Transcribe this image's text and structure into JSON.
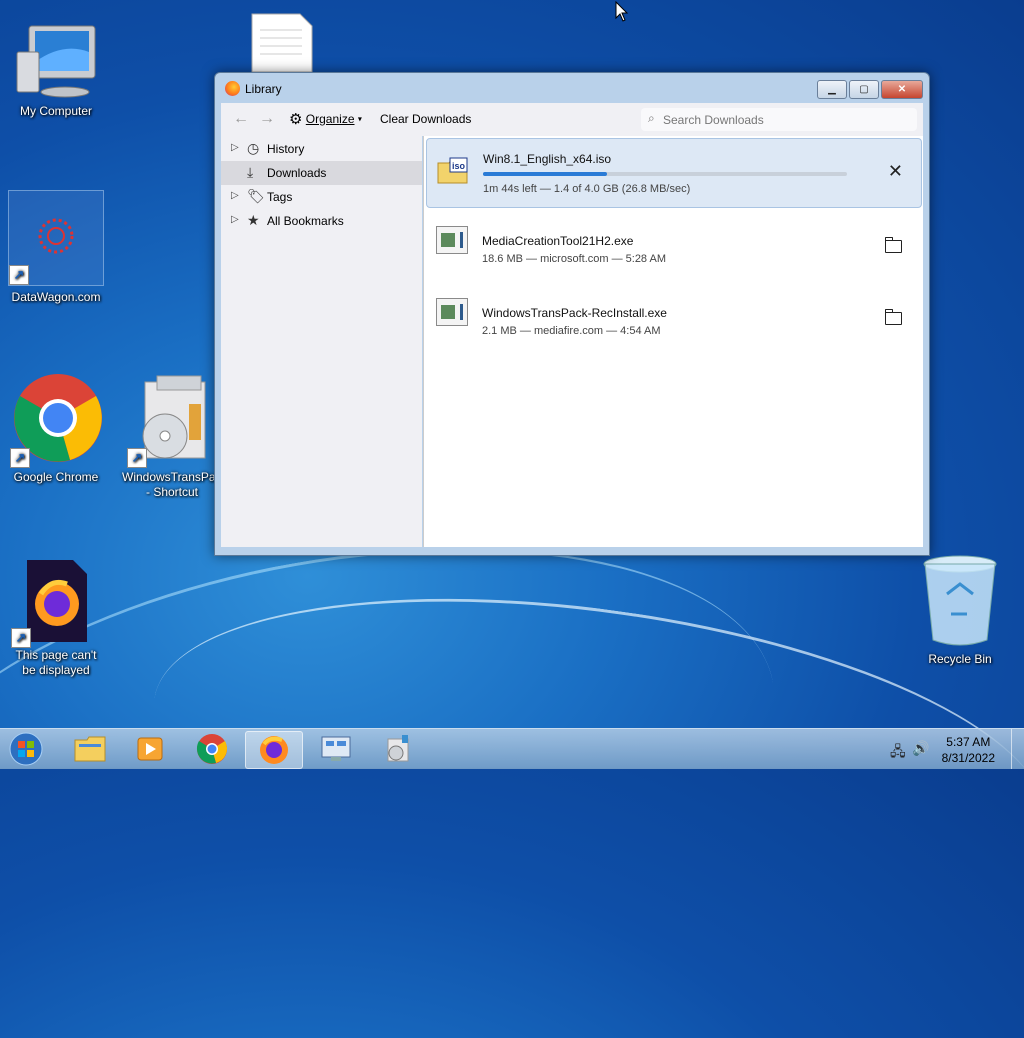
{
  "desktop": {
    "icons": [
      {
        "label": "My Computer"
      },
      {
        "label": "DataWagon.com"
      },
      {
        "label": "Google Chrome"
      },
      {
        "label": "WindowsTransPack - Shortcut"
      },
      {
        "label": "This page can't be displayed"
      },
      {
        "label": "Recycle Bin"
      }
    ]
  },
  "window": {
    "title": "Library",
    "toolbar": {
      "organize_label": "Organize",
      "clear_label": "Clear Downloads",
      "search_placeholder": "Search Downloads"
    },
    "sidebar": {
      "items": [
        {
          "label": "History",
          "icon": "clock-icon"
        },
        {
          "label": "Downloads",
          "icon": "download-icon",
          "selected": true
        },
        {
          "label": "Tags",
          "icon": "tag-icon"
        },
        {
          "label": "All Bookmarks",
          "icon": "star-icon"
        }
      ]
    },
    "downloads": [
      {
        "name": "Win8.1_English_x64.iso",
        "status": "1m 44s left — 1.4 of 4.0 GB (26.8 MB/sec)",
        "progress": 0.34,
        "icon_text": "iso"
      },
      {
        "name": "MediaCreationTool21H2.exe",
        "status": "18.6 MB — microsoft.com — 5:28 AM"
      },
      {
        "name": "WindowsTransPack-RecInstall.exe",
        "status": "2.1 MB — mediafire.com — 4:54 AM"
      }
    ]
  },
  "taskbar": {
    "time": "5:37 AM",
    "date": "8/31/2022"
  },
  "colors": {
    "accent": "#2a7bd6",
    "selection": "#dde8f5"
  }
}
